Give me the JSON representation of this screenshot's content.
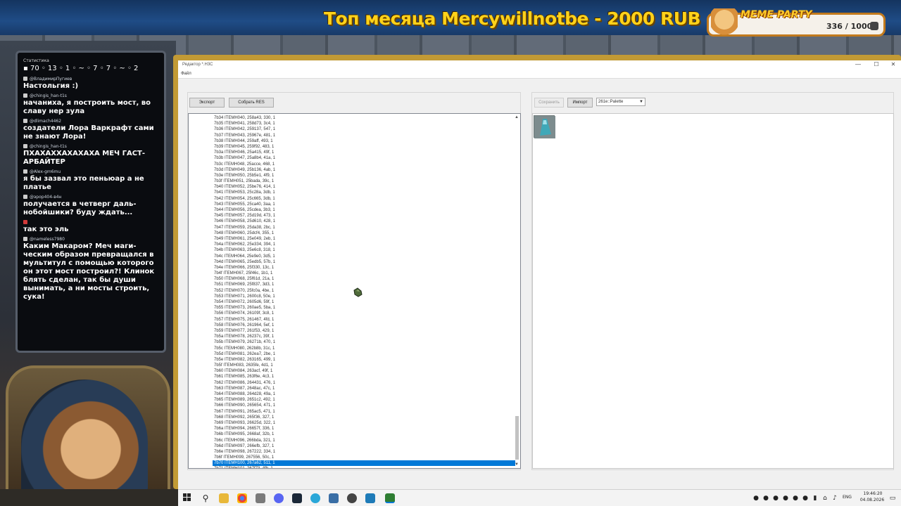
{
  "banner": {
    "title": "Топ месяца Mercywillnotbe - 2000 RUB"
  },
  "meme_widget": {
    "title": "MEME PARTY",
    "progress": "336 / 1000"
  },
  "chat": {
    "stats_title": "Статистика",
    "stats_row": "▪ 70 ◦ 13 ◦ 1 ◦ ~ ◦ 7 ◦ 7 ◦ ~ ◦ 2",
    "messages": [
      {
        "author": "@ВладимирПугиев",
        "text": "Настольгия :)"
      },
      {
        "author": "@chingis_han-t1s",
        "text": "начаниха, я построить мост, во славу нер зула"
      },
      {
        "author": "@dlimach4462",
        "text": "создатели Лора Варкрафт сами не знают Лора!"
      },
      {
        "author": "@chingis_han-t1s",
        "text": "ПХАХАХХАХАХАХА МЕЧ ГАСТ-АРБАЙТЕР"
      },
      {
        "author": "@Alex-gm6mu",
        "text": "я бы зазвал это пеньюар а не платье"
      },
      {
        "author": "@эрор404-в4н",
        "text": "получается в четверг даль-нобойшики? буду ждать..."
      },
      {
        "author": "",
        "text": "так это эль"
      },
      {
        "author": "@nameless7980",
        "text": "Каким Макаром? Меч маги-ческим образом превращался в мультитул с помощью которого он этот мост построил?! Клинок блять сделан, так бы души вынимать, а ни мосты строить, сука!"
      }
    ]
  },
  "editor": {
    "title": "Редактор *.H3C",
    "menu_file": "Файл",
    "export_label": "Экспорт",
    "collect_label": "Собрать RES",
    "save_label": "Сохранить",
    "import_label": "Импорт",
    "palette_value": "261e::Palette",
    "win_min": "—",
    "win_max": "☐",
    "win_close": "✕"
  },
  "tree_rows": [
    "7b34  ITEMH040, 258a43, 330, 1",
    "7b35  ITEMH041, 258d73, 3c4, 1",
    "7b36  ITEMH042, 259137, 547, 1",
    "7b37  ITEMH043, 25967e, 481, 1",
    "7b38  ITEMH044, 259aff, 493, 1",
    "7b39  ITEMH045, 259f92, 483, 1",
    "7b3a  ITEMH046, 25a415, 49f, 1",
    "7b3b  ITEMH047, 25a8b4, 41a, 1",
    "7b3c  ITEMH048, 25acce, 468, 1",
    "7b3d  ITEMH049, 25b136, 4ab, 1",
    "7b3e  ITEMH050, 25b5e1, 4f9, 1",
    "7b3f  ITEMH051, 25bada, 39c, 1",
    "7b40  ITEMH052, 25be76, 414, 1",
    "7b41  ITEMH053, 25c28a, 3db, 1",
    "7b42  ITEMH054, 25c665, 3db, 1",
    "7b43  ITEMH055, 25ca40, 3aa, 1",
    "7b44  ITEMH056, 25cdea, 3b3, 1",
    "7b45  ITEMH057, 25d19d, 473, 1",
    "7b46  ITEMH058, 25d610, 428, 1",
    "7b47  ITEMH059, 25da38, 2bc, 1",
    "7b48  ITEMH060, 25dcf4, 355, 1",
    "7b49  ITEMH061, 25e049, 2eb, 1",
    "7b4a  ITEMH062, 25e334, 394, 1",
    "7b4b  ITEMH063, 25e6c8, 318, 1",
    "7b4c  ITEMH064, 25e9e0, 3d5, 1",
    "7b4d  ITEMH065, 25edb5, 57b, 1",
    "7b4e  ITEMH066, 25f330, 13c, 1",
    "7b4f  ITEMH067, 25f46c, 1b1, 1",
    "7b50  ITEMH068, 25f61d, 21a, 1",
    "7b51  ITEMH069, 25f837, 3d3, 1",
    "7b52  ITEMH070, 25fc0a, 4be, 1",
    "7b53  ITEMH071, 2600c8, 50e, 1",
    "7b54  ITEMH072, 2605d6, 59f, 1",
    "7b55  ITEMH073, 260ae5, 5ba, 1",
    "7b56  ITEMH074, 26109f, 3c8, 1",
    "7b57  ITEMH075, 261467, 4fd, 1",
    "7b58  ITEMH076, 261964, 5ef, 1",
    "7b59  ITEMH077, 261f53, 429, 1",
    "7b5a  ITEMH078, 26237c, 39f, 1",
    "7b5b  ITEMH079, 26271b, 470, 1",
    "7b5c  ITEMH080, 262b8b, 31c, 1",
    "7b5d  ITEMH081, 262ea7, 2be, 1",
    "7b5e  ITEMH082, 263165, 499, 1",
    "7b5f  ITEMH083, 2635fe, 4d1, 1",
    "7b60  ITEMH084, 263acf, 49f, 1",
    "7b61  ITEMH085, 263f6e, 4c3, 1",
    "7b62  ITEMH086, 264431, 476, 1",
    "7b63  ITEMH087, 2648ac, 47c, 1",
    "7b64  ITEMH088, 264d28, 49a, 1",
    "7b65  ITEMH089, 2651c2, 492, 1",
    "7b66  ITEMH090, 265654, 471, 1",
    "7b67  ITEMH091, 265ac5, 471, 1",
    "7b68  ITEMH092, 265f36, 327, 1",
    "7b69  ITEMH093, 26625d, 322, 1",
    "7b6a  ITEMH094, 26657f, 336, 1",
    "7b6b  ITEMH095, 2668af, 32b, 1",
    "7b6c  ITEMH096, 266bda, 321, 1",
    "7b6d  ITEMH097, 266efb, 327, 1",
    "7b6e  ITEMH098, 267222, 334, 1",
    "7b6f  ITEMH099, 267556, 50c, 1",
    "7b70  ITEMH100, 267a62, 511, 1",
    "7b71  ITEMH101, 267f73, 4fb, 1"
  ],
  "selected_row": 60,
  "taskbar": {
    "lang": "ENG",
    "time": "19:46:20",
    "date": "04.08.2026"
  }
}
